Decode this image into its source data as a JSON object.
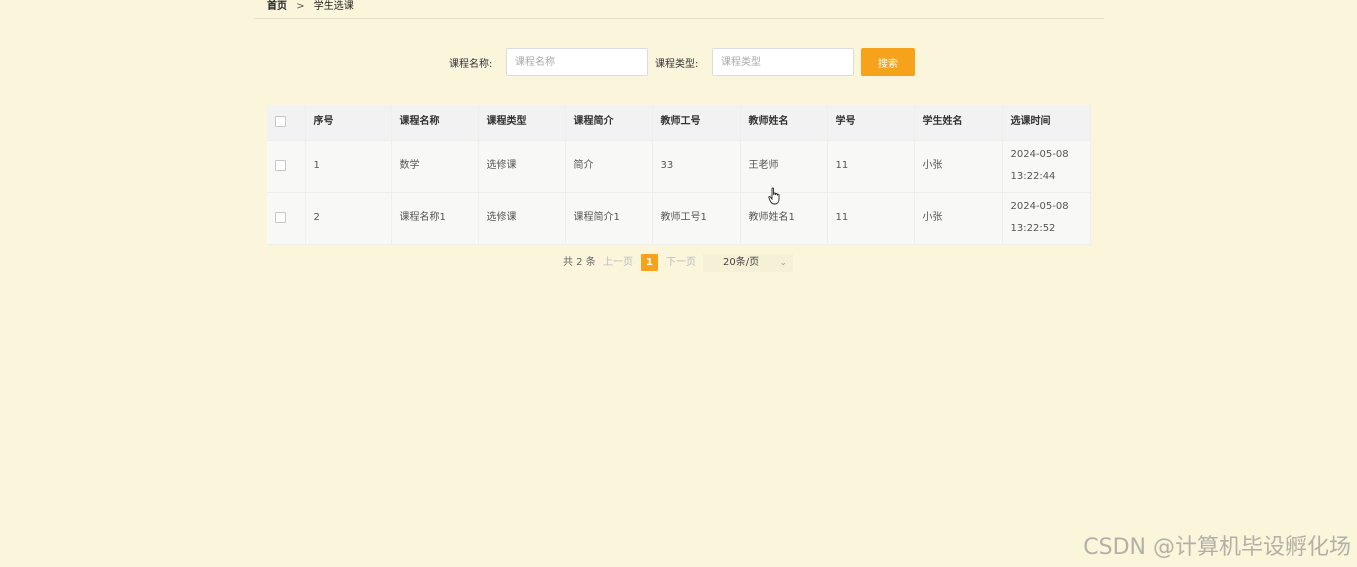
{
  "breadcrumb": {
    "home": "首页",
    "separator": ">",
    "current": "学生选课"
  },
  "search": {
    "course_name_label": "课程名称:",
    "course_name_placeholder": "课程名称",
    "course_type_label": "课程类型:",
    "course_type_placeholder": "课程类型",
    "search_button": "搜索"
  },
  "table": {
    "headers": [
      "序号",
      "课程名称",
      "课程类型",
      "课程简介",
      "教师工号",
      "教师姓名",
      "学号",
      "学生姓名",
      "选课时间"
    ],
    "rows": [
      [
        "1",
        "数学",
        "选修课",
        "简介",
        "33",
        "王老师",
        "11",
        "小张",
        "2024-05-08 13:22:44"
      ],
      [
        "2",
        "课程名称1",
        "选修课",
        "课程简介1",
        "教师工号1",
        "教师姓名1",
        "11",
        "小张",
        "2024-05-08 13:22:52"
      ]
    ]
  },
  "pagination": {
    "total": "共 2 条",
    "prev": "上一页",
    "current_page": "1",
    "next": "下一页",
    "page_size": "20条/页"
  },
  "watermark": "CSDN @计算机毕设孵化场",
  "colors": {
    "accent": "#f7a21b",
    "background": "#fbf5dc"
  }
}
